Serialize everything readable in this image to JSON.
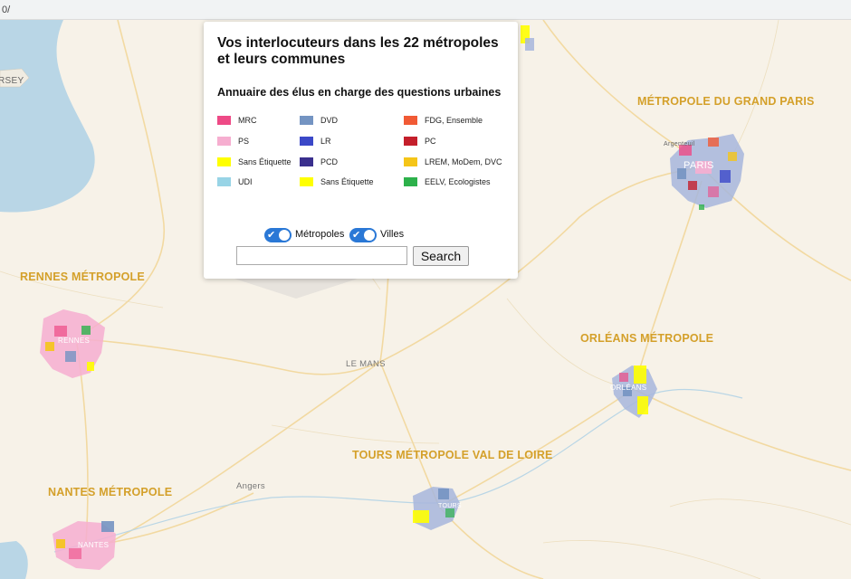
{
  "url_fragment": "0/",
  "panel": {
    "title": "Vos interlocuteurs dans les 22 métropoles et leurs communes",
    "subtitle": "Annuaire des élus en charge des questions urbaines",
    "legend_col1": [
      {
        "label": "MRC",
        "color": "#ee4a86"
      },
      {
        "label": "PS",
        "color": "#f6aed0"
      },
      {
        "label": "Sans Étiquette",
        "color": "#ffff00"
      },
      {
        "label": "UDI",
        "color": "#98d4e6"
      }
    ],
    "legend_col2": [
      {
        "label": "DVD",
        "color": "#7494c2"
      },
      {
        "label": "LR",
        "color": "#3b48c8"
      },
      {
        "label": "PCD",
        "color": "#3a2f8d"
      },
      {
        "label": "Sans Étiquette",
        "color": "#ffff00"
      }
    ],
    "legend_col3": [
      {
        "label": "FDG, Ensemble",
        "color": "#f15a35"
      },
      {
        "label": "PC",
        "color": "#c41f2b"
      },
      {
        "label": "LREM, MoDem, DVC",
        "color": "#f5c518"
      },
      {
        "label": "EELV, Ecologistes",
        "color": "#2db14b"
      }
    ],
    "toggle_metropoles": "Métropoles",
    "toggle_villes": "Villes",
    "search_value": "",
    "search_button": "Search"
  },
  "map": {
    "metropole_labels": [
      "MÉTROPOLE DU GRAND PARIS",
      "RENNES MÉTROPOLE",
      "ORLÉANS MÉTROPOLE",
      "TOURS MÉTROPOLE VAL DE LOIRE",
      "NANTES MÉTROPOLE"
    ],
    "city_labels": [
      "RSEY",
      "LE MANS",
      "Angers",
      "PARIS",
      "RENNES",
      "ORLÉANS",
      "NANTES",
      "Argenteuil",
      "TOURS"
    ],
    "colors": {
      "land": "#f7f2e8",
      "water": "#b9d6e6",
      "road": "#f2d79a",
      "label": "#d4a02a"
    }
  }
}
